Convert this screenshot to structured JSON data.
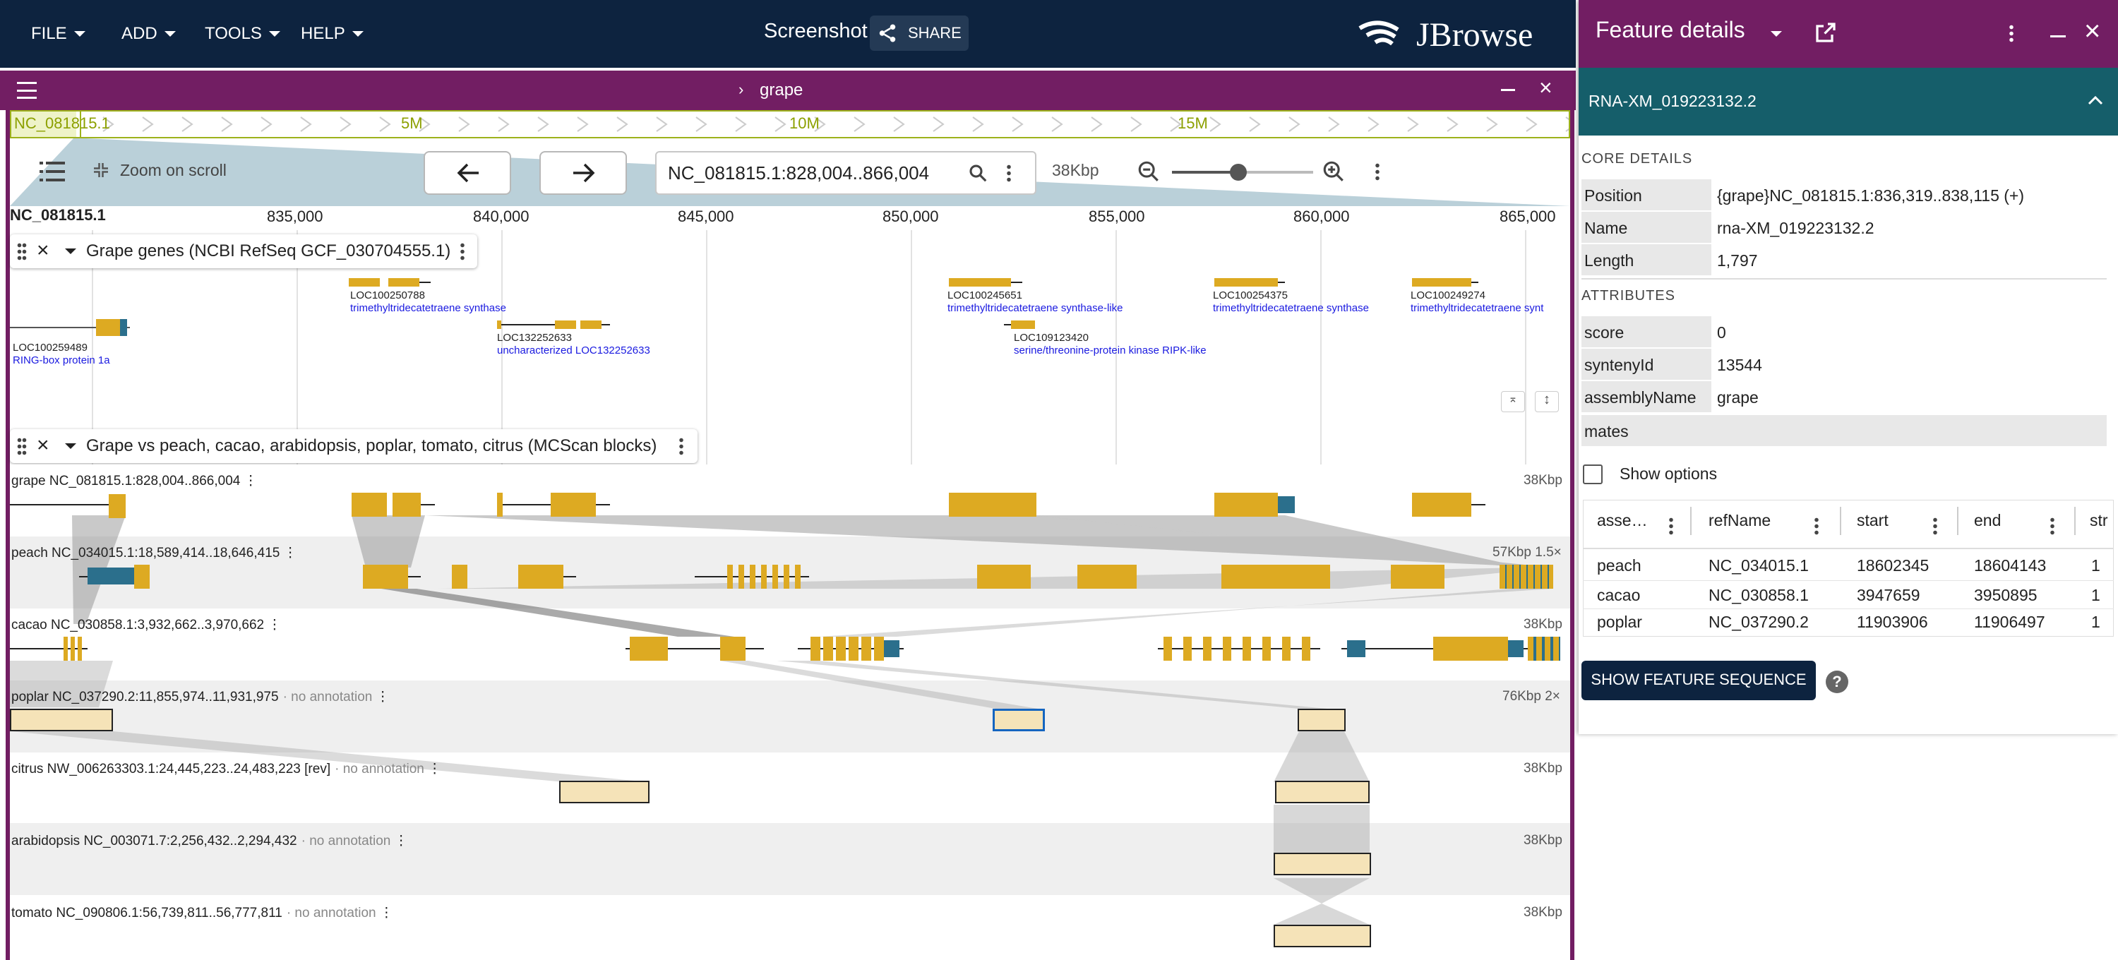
{
  "appbar": {
    "menus": [
      "FILE",
      "ADD",
      "TOOLS",
      "HELP"
    ],
    "session_name": "Screenshot",
    "share_label": "SHARE",
    "logo_text": "JBrowse"
  },
  "view": {
    "title": "grape",
    "overview": {
      "ref": "NC_081815.1",
      "ticks": [
        "5M",
        "10M",
        "15M"
      ]
    },
    "zoom_on_scroll": "Zoom on scroll",
    "location": "NC_081815.1:828,004..866,004",
    "span": "38Kbp",
    "scale": {
      "ref": "NC_081815.1",
      "ticks": [
        "835,000",
        "840,000",
        "845,000",
        "850,000",
        "855,000",
        "860,000",
        "865,000"
      ]
    }
  },
  "genes_track": {
    "title": "Grape genes (NCBI RefSeq GCF_030704555.1)",
    "genes": [
      {
        "name": "LOC100259489",
        "desc": "RING-box protein 1a"
      },
      {
        "name": "LOC100250788",
        "desc": "trimethyltridecatetraene synthase"
      },
      {
        "name": "LOC132252633",
        "desc": "uncharacterized LOC132252633"
      },
      {
        "name": "LOC100245651",
        "desc": "trimethyltridecatetraene synthase-like"
      },
      {
        "name": "LOC109123420",
        "desc": "serine/threonine-protein kinase RIPK-like"
      },
      {
        "name": "LOC100254375",
        "desc": "trimethyltridecatetraene synthase"
      },
      {
        "name": "LOC100249274",
        "desc": "trimethyltridecatetraene synt"
      }
    ]
  },
  "synteny_track": {
    "title": "Grape vs peach, cacao, arabidopsis, poplar, tomato, citrus (MCScan blocks)",
    "rows": [
      {
        "label": "grape NC_081815.1:828,004..866,004",
        "note": "",
        "size": "38Kbp"
      },
      {
        "label": "peach NC_034015.1:18,589,414..18,646,415",
        "note": "",
        "size": "57Kbp 1.5×"
      },
      {
        "label": "cacao NC_030858.1:3,932,662..3,970,662",
        "note": "",
        "size": "38Kbp"
      },
      {
        "label": "poplar NC_037290.2:11,855,974..11,931,975",
        "note": "· no annotation",
        "size": "76Kbp 2×"
      },
      {
        "label": "citrus NW_006263303.1:24,445,223..24,483,223 [rev]",
        "note": "· no annotation",
        "size": "38Kbp"
      },
      {
        "label": "arabidopsis NC_003071.7:2,256,432..2,294,432",
        "note": "· no annotation",
        "size": "38Kbp"
      },
      {
        "label": "tomato NC_090806.1:56,739,811..56,777,811",
        "note": "· no annotation",
        "size": "38Kbp"
      }
    ]
  },
  "panel": {
    "title": "Feature details",
    "feature_header": "RNA-XM_019223132.2",
    "core_title": "CORE DETAILS",
    "core": [
      {
        "k": "Position",
        "v": "{grape}NC_081815.1:836,319..838,115 (+)"
      },
      {
        "k": "Name",
        "v": "rna-XM_019223132.2"
      },
      {
        "k": "Length",
        "v": "1,797"
      }
    ],
    "attr_title": "ATTRIBUTES",
    "attrs": [
      {
        "k": "score",
        "v": "0"
      },
      {
        "k": "syntenyId",
        "v": "13544"
      },
      {
        "k": "assemblyName",
        "v": "grape"
      }
    ],
    "mates_label": "mates",
    "show_options": "Show options",
    "table": {
      "headers": [
        "asse…",
        "refName",
        "start",
        "end",
        "str"
      ],
      "rows": [
        [
          "peach",
          "NC_034015.1",
          "18602345",
          "18604143",
          "1"
        ],
        [
          "cacao",
          "NC_030858.1",
          "3947659",
          "3950895",
          "1"
        ],
        [
          "poplar",
          "NC_037290.2",
          "11903906",
          "11906497",
          "1"
        ]
      ]
    },
    "seq_button": "SHOW FEATURE SEQUENCE",
    "help": "?"
  },
  "colors": {
    "appbar": "#0d233f",
    "view_header": "#721e63",
    "feature_header": "#155e6a",
    "exon": "#ddaa22",
    "utr": "#2b6f8c",
    "link": "#1a1ae0"
  }
}
